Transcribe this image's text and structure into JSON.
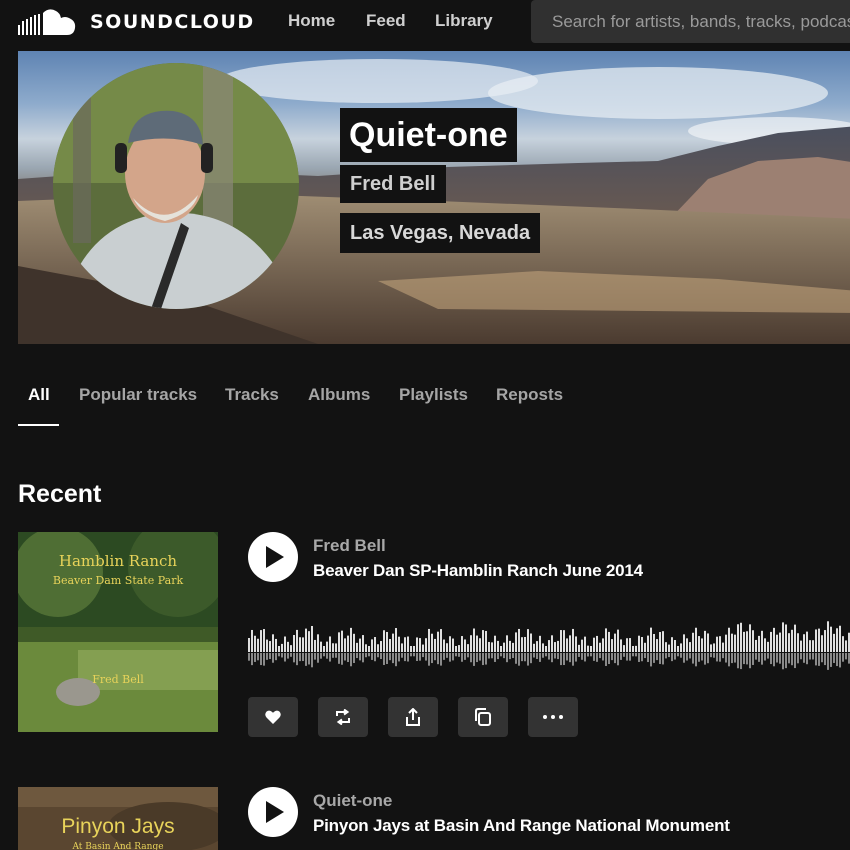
{
  "header": {
    "brand": "SOUNDCLOUD",
    "nav": [
      "Home",
      "Feed",
      "Library"
    ],
    "search_placeholder": "Search for artists, bands, tracks, podcasts"
  },
  "profile": {
    "display_name": "Quiet-one",
    "full_name": "Fred Bell",
    "location": "Las Vegas, Nevada"
  },
  "tabs": [
    "All",
    "Popular tracks",
    "Tracks",
    "Albums",
    "Playlists",
    "Reposts"
  ],
  "active_tab": "All",
  "recent": {
    "heading": "Recent",
    "tracks": [
      {
        "artist": "Fred Bell",
        "title": "Beaver Dan SP-Hamblin Ranch June 2014",
        "artwork_title": "Hamblin Ranch",
        "artwork_subtitle": "Beaver Dam State Park",
        "artwork_credit": "Fred Bell"
      },
      {
        "artist": "Quiet-one",
        "title": "Pinyon Jays at Basin And Range National Monument",
        "artwork_title": "Pinyon Jays",
        "artwork_subtitle": "At Basin And Range"
      }
    ]
  },
  "actions": [
    "heart-icon",
    "repost-icon",
    "share-icon",
    "copy-icon",
    "more-icon"
  ],
  "colors": {
    "background": "#121212",
    "button": "#333333",
    "art_text": "#e8d35a"
  }
}
